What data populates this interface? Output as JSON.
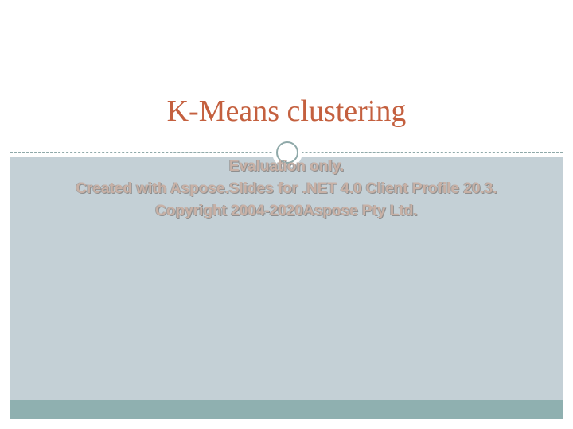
{
  "slide": {
    "title": "K-Means clustering",
    "watermark": [
      "Evaluation only.",
      "Created with Aspose.Slides for .NET 4.0 Client Profile 20.3.",
      "Copyright 2004-2020Aspose Pty Ltd."
    ]
  },
  "colors": {
    "title": "#c4603f",
    "body_background": "#c4d0d6",
    "bottom_bar": "#8fb0b0",
    "accent_line": "#8fa9a9",
    "watermark_text": "#c8b1a6"
  }
}
